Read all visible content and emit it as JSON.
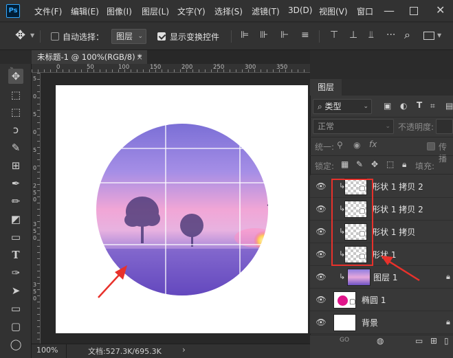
{
  "app": {
    "logo_text": "Ps",
    "menu": [
      "文件(F)",
      "编辑(E)",
      "图像(I)",
      "图层(L)",
      "文字(Y)",
      "选择(S)",
      "滤镜(T)",
      "3D(D)",
      "视图(V)",
      "窗口"
    ]
  },
  "options_bar": {
    "auto_select_label": "自动选择：",
    "auto_select_checked": false,
    "target_select_value": "图层",
    "show_transform_label": "显示变换控件",
    "show_transform_checked": true
  },
  "document_tab": {
    "title": "未标题-1 @ 100%(RGB/8) *",
    "close_glyph": "×"
  },
  "ruler_numbers": {
    "horizontal": [
      "0",
      "50",
      "100",
      "150",
      "200",
      "250",
      "300",
      "350"
    ],
    "vertical": [
      "5",
      "0",
      "5",
      "0",
      "5",
      "0",
      "2",
      "5",
      "0",
      "3",
      "5",
      "0",
      "3",
      "5",
      "0"
    ]
  },
  "status_bar": {
    "zoom": "100%",
    "doc_info": "文档:527.3K/695.3K",
    "arrow": "›"
  },
  "layers_panel": {
    "tab_label": "图层",
    "filter_kind": "类型",
    "blend_mode": "正常",
    "opacity_label": "不透明度:",
    "unify_label": "统一:",
    "propagate_label": "传播",
    "lock_label": "锁定:",
    "fill_label": "填充:",
    "layers": [
      {
        "name": "形状 1 拷贝 2",
        "visible": true,
        "clipped": true,
        "thumb": "checker"
      },
      {
        "name": "形状 1 拷贝 2",
        "visible": true,
        "clipped": true,
        "thumb": "checker"
      },
      {
        "name": "形状 1 拷贝",
        "visible": true,
        "clipped": true,
        "thumb": "checker"
      },
      {
        "name": "形状 1",
        "visible": true,
        "clipped": true,
        "thumb": "checker"
      },
      {
        "name": "图层 1",
        "visible": true,
        "clipped": true,
        "thumb": "photo",
        "locked": true
      },
      {
        "name": "椭圆 1",
        "visible": true,
        "clipped": false,
        "thumb": "ellipse"
      },
      {
        "name": "背景",
        "visible": true,
        "clipped": false,
        "thumb": "white",
        "locked": true
      }
    ],
    "footer_label": "GO"
  },
  "colors": {
    "annotation_red": "#e8312b",
    "ellipse_thumb": "#e0148a",
    "accent_blue": "#31a8ff"
  }
}
